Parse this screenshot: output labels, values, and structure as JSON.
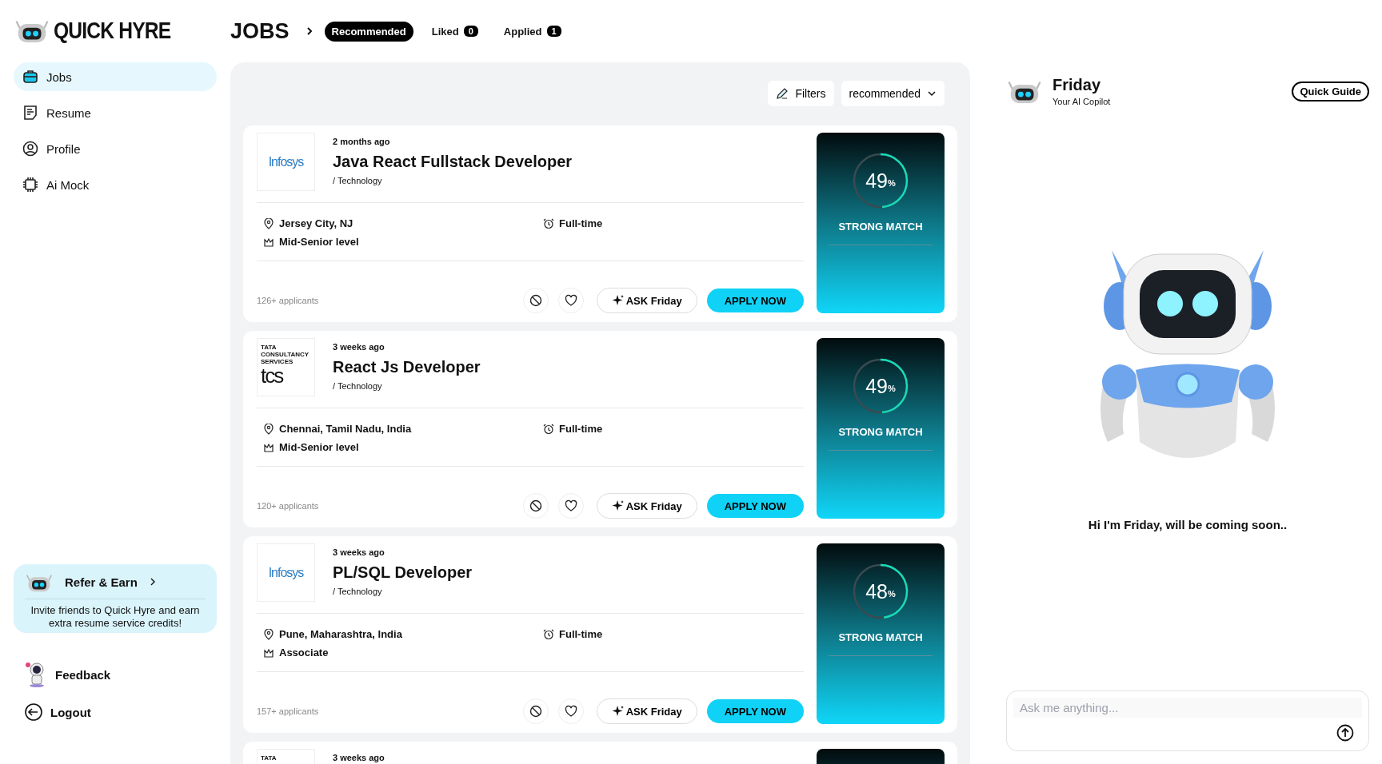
{
  "brand": {
    "name": "QUICK HYRE"
  },
  "sidebar": {
    "items": [
      {
        "label": "Jobs",
        "kind": "jobs",
        "selected": true
      },
      {
        "label": "Resume",
        "kind": "resume",
        "selected": false
      },
      {
        "label": "Profile",
        "kind": "profile",
        "selected": false
      },
      {
        "label": "Ai Mock",
        "kind": "aimock",
        "selected": false
      }
    ],
    "refer": {
      "title": "Refer & Earn",
      "text": "Invite friends to Quick Hyre and earn extra resume service credits!"
    },
    "feedback": "Feedback",
    "logout": "Logout"
  },
  "header": {
    "title": "JOBS",
    "tabs": [
      {
        "label": "Recommended",
        "selected": true
      },
      {
        "label": "Liked",
        "count": "0",
        "selected": false
      },
      {
        "label": "Applied",
        "count": "1",
        "selected": false
      }
    ]
  },
  "toolbar": {
    "filters": "Filters",
    "sort": "recommended"
  },
  "jobs": [
    {
      "logo": {
        "kind": "infosys",
        "text": "Infosys"
      },
      "posted": "2 months ago",
      "title": "Java React Fullstack Developer",
      "category": "/ Technology",
      "location": "Jersey City, NJ",
      "type": "Full-time",
      "level_text": "Mid-Senior level",
      "applicants": "126+ applicants",
      "ask": "ASK Friday",
      "apply": "APPLY NOW",
      "match": {
        "value": "49",
        "unit": "%",
        "level": 0.49,
        "label": "STRONG MATCH"
      }
    },
    {
      "logo": {
        "kind": "tcs",
        "small": "TATA CONSULTANCY SERVICES",
        "text": "tcs"
      },
      "posted": "3 weeks ago",
      "title": "React Js Developer",
      "category": "/ Technology",
      "location": "Chennai, Tamil Nadu, India",
      "type": "Full-time",
      "level_text": "Mid-Senior level",
      "applicants": "120+ applicants",
      "ask": "ASK Friday",
      "apply": "APPLY NOW",
      "match": {
        "value": "49",
        "unit": "%",
        "level": 0.49,
        "label": "STRONG MATCH"
      }
    },
    {
      "logo": {
        "kind": "infosys",
        "text": "Infosys"
      },
      "posted": "3 weeks ago",
      "title": "PL/SQL Developer",
      "category": "/ Technology",
      "location": "Pune, Maharashtra, India",
      "type": "Full-time",
      "level_text": "Associate",
      "applicants": "157+ applicants",
      "ask": "ASK Friday",
      "apply": "APPLY NOW",
      "match": {
        "value": "48",
        "unit": "%",
        "level": 0.48,
        "label": "STRONG MATCH"
      }
    },
    {
      "logo": {
        "kind": "tcs",
        "small": "TATA"
      },
      "posted": "3 weeks ago"
    }
  ],
  "copilot": {
    "name": "Friday",
    "subtitle": "Your AI Copilot",
    "guide": "Quick Guide",
    "message": "Hi I'm Friday, will be coming soon..",
    "placeholder": "Ask me anything..."
  }
}
